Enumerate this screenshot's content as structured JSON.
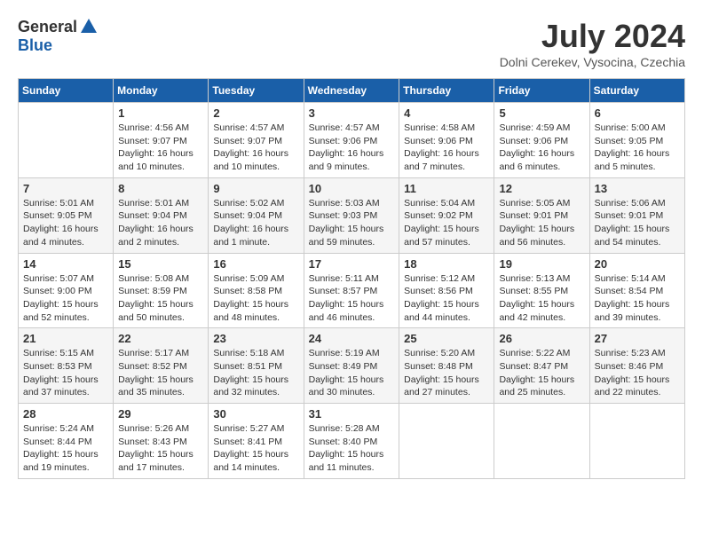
{
  "header": {
    "logo_general": "General",
    "logo_blue": "Blue",
    "month_title": "July 2024",
    "location": "Dolni Cerekev, Vysocina, Czechia"
  },
  "calendar": {
    "days_of_week": [
      "Sunday",
      "Monday",
      "Tuesday",
      "Wednesday",
      "Thursday",
      "Friday",
      "Saturday"
    ],
    "weeks": [
      [
        {
          "day": "",
          "info": ""
        },
        {
          "day": "1",
          "info": "Sunrise: 4:56 AM\nSunset: 9:07 PM\nDaylight: 16 hours\nand 10 minutes."
        },
        {
          "day": "2",
          "info": "Sunrise: 4:57 AM\nSunset: 9:07 PM\nDaylight: 16 hours\nand 10 minutes."
        },
        {
          "day": "3",
          "info": "Sunrise: 4:57 AM\nSunset: 9:06 PM\nDaylight: 16 hours\nand 9 minutes."
        },
        {
          "day": "4",
          "info": "Sunrise: 4:58 AM\nSunset: 9:06 PM\nDaylight: 16 hours\nand 7 minutes."
        },
        {
          "day": "5",
          "info": "Sunrise: 4:59 AM\nSunset: 9:06 PM\nDaylight: 16 hours\nand 6 minutes."
        },
        {
          "day": "6",
          "info": "Sunrise: 5:00 AM\nSunset: 9:05 PM\nDaylight: 16 hours\nand 5 minutes."
        }
      ],
      [
        {
          "day": "7",
          "info": "Sunrise: 5:01 AM\nSunset: 9:05 PM\nDaylight: 16 hours\nand 4 minutes."
        },
        {
          "day": "8",
          "info": "Sunrise: 5:01 AM\nSunset: 9:04 PM\nDaylight: 16 hours\nand 2 minutes."
        },
        {
          "day": "9",
          "info": "Sunrise: 5:02 AM\nSunset: 9:04 PM\nDaylight: 16 hours\nand 1 minute."
        },
        {
          "day": "10",
          "info": "Sunrise: 5:03 AM\nSunset: 9:03 PM\nDaylight: 15 hours\nand 59 minutes."
        },
        {
          "day": "11",
          "info": "Sunrise: 5:04 AM\nSunset: 9:02 PM\nDaylight: 15 hours\nand 57 minutes."
        },
        {
          "day": "12",
          "info": "Sunrise: 5:05 AM\nSunset: 9:01 PM\nDaylight: 15 hours\nand 56 minutes."
        },
        {
          "day": "13",
          "info": "Sunrise: 5:06 AM\nSunset: 9:01 PM\nDaylight: 15 hours\nand 54 minutes."
        }
      ],
      [
        {
          "day": "14",
          "info": "Sunrise: 5:07 AM\nSunset: 9:00 PM\nDaylight: 15 hours\nand 52 minutes."
        },
        {
          "day": "15",
          "info": "Sunrise: 5:08 AM\nSunset: 8:59 PM\nDaylight: 15 hours\nand 50 minutes."
        },
        {
          "day": "16",
          "info": "Sunrise: 5:09 AM\nSunset: 8:58 PM\nDaylight: 15 hours\nand 48 minutes."
        },
        {
          "day": "17",
          "info": "Sunrise: 5:11 AM\nSunset: 8:57 PM\nDaylight: 15 hours\nand 46 minutes."
        },
        {
          "day": "18",
          "info": "Sunrise: 5:12 AM\nSunset: 8:56 PM\nDaylight: 15 hours\nand 44 minutes."
        },
        {
          "day": "19",
          "info": "Sunrise: 5:13 AM\nSunset: 8:55 PM\nDaylight: 15 hours\nand 42 minutes."
        },
        {
          "day": "20",
          "info": "Sunrise: 5:14 AM\nSunset: 8:54 PM\nDaylight: 15 hours\nand 39 minutes."
        }
      ],
      [
        {
          "day": "21",
          "info": "Sunrise: 5:15 AM\nSunset: 8:53 PM\nDaylight: 15 hours\nand 37 minutes."
        },
        {
          "day": "22",
          "info": "Sunrise: 5:17 AM\nSunset: 8:52 PM\nDaylight: 15 hours\nand 35 minutes."
        },
        {
          "day": "23",
          "info": "Sunrise: 5:18 AM\nSunset: 8:51 PM\nDaylight: 15 hours\nand 32 minutes."
        },
        {
          "day": "24",
          "info": "Sunrise: 5:19 AM\nSunset: 8:49 PM\nDaylight: 15 hours\nand 30 minutes."
        },
        {
          "day": "25",
          "info": "Sunrise: 5:20 AM\nSunset: 8:48 PM\nDaylight: 15 hours\nand 27 minutes."
        },
        {
          "day": "26",
          "info": "Sunrise: 5:22 AM\nSunset: 8:47 PM\nDaylight: 15 hours\nand 25 minutes."
        },
        {
          "day": "27",
          "info": "Sunrise: 5:23 AM\nSunset: 8:46 PM\nDaylight: 15 hours\nand 22 minutes."
        }
      ],
      [
        {
          "day": "28",
          "info": "Sunrise: 5:24 AM\nSunset: 8:44 PM\nDaylight: 15 hours\nand 19 minutes."
        },
        {
          "day": "29",
          "info": "Sunrise: 5:26 AM\nSunset: 8:43 PM\nDaylight: 15 hours\nand 17 minutes."
        },
        {
          "day": "30",
          "info": "Sunrise: 5:27 AM\nSunset: 8:41 PM\nDaylight: 15 hours\nand 14 minutes."
        },
        {
          "day": "31",
          "info": "Sunrise: 5:28 AM\nSunset: 8:40 PM\nDaylight: 15 hours\nand 11 minutes."
        },
        {
          "day": "",
          "info": ""
        },
        {
          "day": "",
          "info": ""
        },
        {
          "day": "",
          "info": ""
        }
      ]
    ]
  }
}
